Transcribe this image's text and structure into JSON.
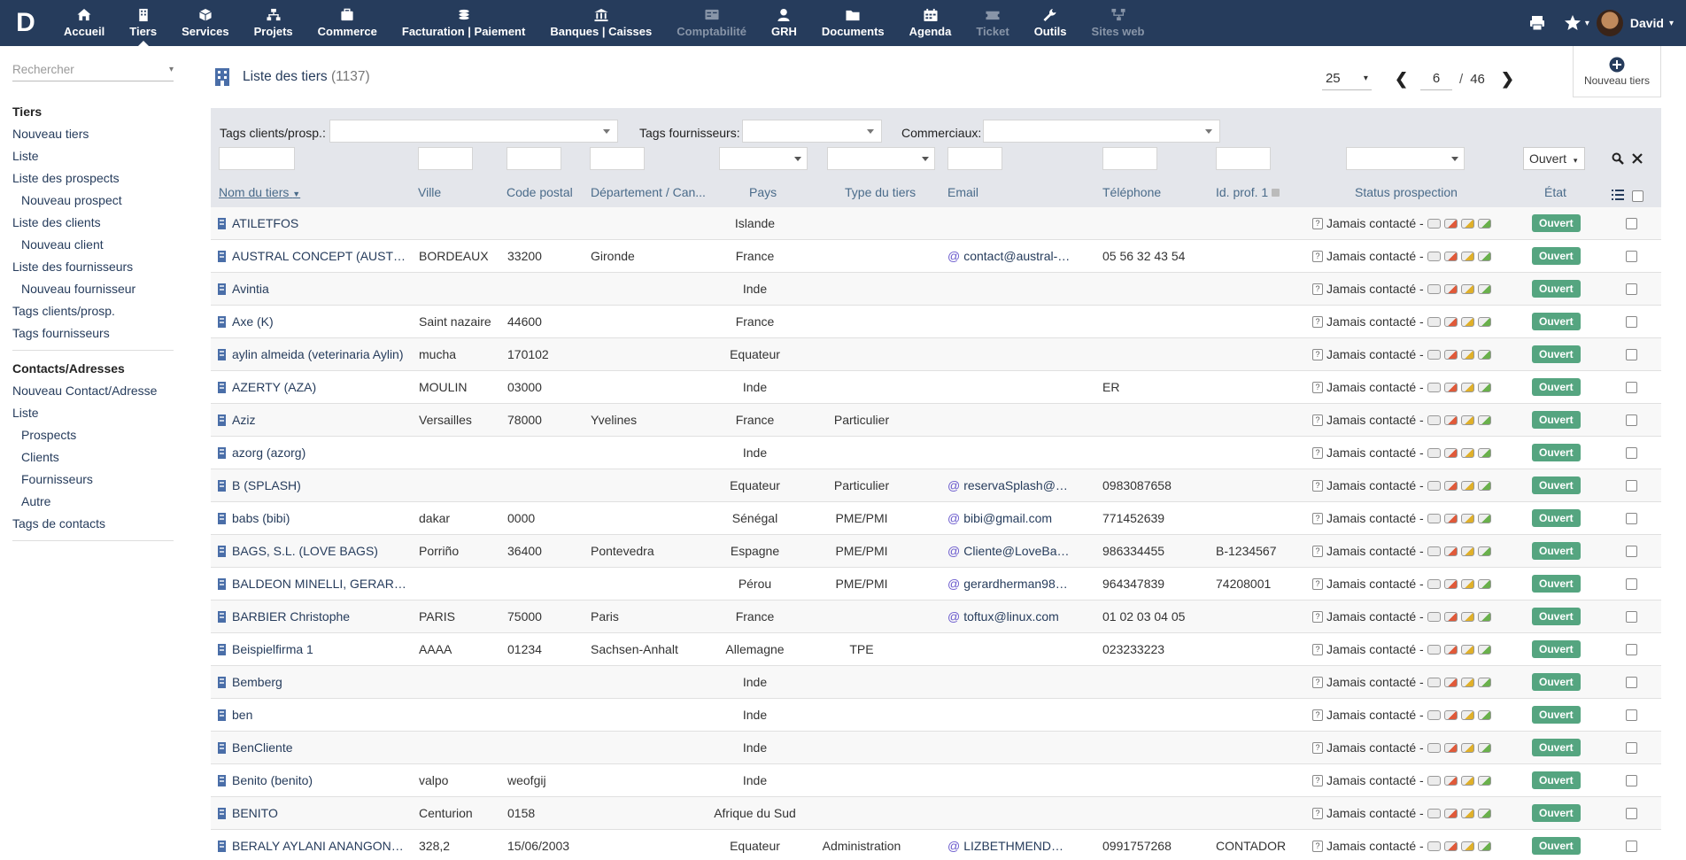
{
  "topbar": {
    "logo": "D",
    "menu": [
      {
        "label": "Accueil",
        "icon": "home-icon",
        "disabled": false
      },
      {
        "label": "Tiers",
        "icon": "building-icon",
        "disabled": false,
        "active": true
      },
      {
        "label": "Services",
        "icon": "cube-icon",
        "disabled": false
      },
      {
        "label": "Projets",
        "icon": "sitemap-icon",
        "disabled": false
      },
      {
        "label": "Commerce",
        "icon": "suitcase-icon",
        "disabled": false
      },
      {
        "label": "Facturation | Paiement",
        "icon": "coins-icon",
        "disabled": false
      },
      {
        "label": "Banques | Caisses",
        "icon": "bank-icon",
        "disabled": false
      },
      {
        "label": "Comptabilité",
        "icon": "ledger-icon",
        "disabled": true
      },
      {
        "label": "GRH",
        "icon": "user-icon",
        "disabled": false
      },
      {
        "label": "Documents",
        "icon": "folder-icon",
        "disabled": false
      },
      {
        "label": "Agenda",
        "icon": "calendar-icon",
        "disabled": false
      },
      {
        "label": "Ticket",
        "icon": "ticket-icon",
        "disabled": true
      },
      {
        "label": "Outils",
        "icon": "wrench-icon",
        "disabled": false
      },
      {
        "label": "Sites web",
        "icon": "network-icon",
        "disabled": true
      }
    ],
    "username": "David"
  },
  "sidebar": {
    "search_placeholder": "Rechercher",
    "sections": [
      {
        "head": "Tiers",
        "links": [
          {
            "label": "Nouveau tiers",
            "sub": false
          },
          {
            "label": "Liste",
            "sub": false
          },
          {
            "label": "Liste des prospects",
            "sub": false
          },
          {
            "label": "Nouveau prospect",
            "sub": true
          },
          {
            "label": "Liste des clients",
            "sub": false
          },
          {
            "label": "Nouveau client",
            "sub": true
          },
          {
            "label": "Liste des fournisseurs",
            "sub": false
          },
          {
            "label": "Nouveau fournisseur",
            "sub": true
          },
          {
            "label": "Tags clients/prosp.",
            "sub": false
          },
          {
            "label": "Tags fournisseurs",
            "sub": false
          }
        ]
      },
      {
        "head": "Contacts/Adresses",
        "links": [
          {
            "label": "Nouveau Contact/Adresse",
            "sub": false
          },
          {
            "label": "Liste",
            "sub": false
          },
          {
            "label": "Prospects",
            "sub": true
          },
          {
            "label": "Clients",
            "sub": true
          },
          {
            "label": "Fournisseurs",
            "sub": true
          },
          {
            "label": "Autre",
            "sub": true
          },
          {
            "label": "Tags de contacts",
            "sub": false
          }
        ]
      }
    ]
  },
  "main": {
    "title": "Liste des tiers",
    "count": "(1137)",
    "per_page": "25",
    "page": "6",
    "page_sep": "/",
    "total_pages": "46",
    "new_button": "Nouveau tiers",
    "filters": {
      "tags_clients_label": "Tags clients/prosp.:",
      "tags_fourn_label": "Tags fournisseurs:",
      "commerciaux_label": "Commerciaux:",
      "etat_value": "Ouvert"
    },
    "columns": {
      "name": "Nom du tiers",
      "ville": "Ville",
      "cp": "Code postal",
      "dep": "Département / Can...",
      "pays": "Pays",
      "type": "Type du tiers",
      "email": "Email",
      "tel": "Téléphone",
      "prof": "Id. prof. 1",
      "status": "Status prospection",
      "etat": "État"
    }
  },
  "rows": [
    {
      "name": "ATILETFOS",
      "ville": "",
      "cp": "",
      "dep": "",
      "pays": "Islande",
      "type": "",
      "email": "",
      "tel": "",
      "prof": "",
      "status": "Jamais contacté -",
      "etat": "Ouvert"
    },
    {
      "name": "AUSTRAL CONCEPT (AUSTRA...",
      "ville": "BORDEAUX",
      "cp": "33200",
      "dep": "Gironde",
      "pays": "France",
      "type": "",
      "email": "contact@austral-con...",
      "tel": "05 56 32 43 54",
      "prof": "",
      "status": "Jamais contacté -",
      "etat": "Ouvert"
    },
    {
      "name": "Avintia",
      "ville": "",
      "cp": "",
      "dep": "",
      "pays": "Inde",
      "type": "",
      "email": "",
      "tel": "",
      "prof": "",
      "status": "Jamais contacté -",
      "etat": "Ouvert"
    },
    {
      "name": "Axe (K)",
      "ville": "Saint nazaire",
      "cp": "44600",
      "dep": "",
      "pays": "France",
      "type": "",
      "email": "",
      "tel": "",
      "prof": "",
      "status": "Jamais contacté -",
      "etat": "Ouvert"
    },
    {
      "name": "aylin almeida (veterinaria Aylin)",
      "ville": "mucha",
      "cp": "170102",
      "dep": "",
      "pays": "Equateur",
      "type": "",
      "email": "",
      "tel": "",
      "prof": "",
      "status": "Jamais contacté -",
      "etat": "Ouvert"
    },
    {
      "name": "AZERTY (AZA)",
      "ville": "MOULIN",
      "cp": "03000",
      "dep": "",
      "pays": "Inde",
      "type": "",
      "email": "",
      "tel": "ER",
      "prof": "",
      "status": "Jamais contacté -",
      "etat": "Ouvert"
    },
    {
      "name": "Aziz",
      "ville": "Versailles",
      "cp": "78000",
      "dep": "Yvelines",
      "pays": "France",
      "type": "Particulier",
      "email": "",
      "tel": "",
      "prof": "",
      "status": "Jamais contacté -",
      "etat": "Ouvert"
    },
    {
      "name": "azorg (azorg)",
      "ville": "",
      "cp": "",
      "dep": "",
      "pays": "Inde",
      "type": "",
      "email": "",
      "tel": "",
      "prof": "",
      "status": "Jamais contacté -",
      "etat": "Ouvert"
    },
    {
      "name": "B (SPLASH)",
      "ville": "",
      "cp": "",
      "dep": "",
      "pays": "Equateur",
      "type": "Particulier",
      "email": "reservaSplash@hotm...",
      "tel": "0983087658",
      "prof": "",
      "status": "Jamais contacté -",
      "etat": "Ouvert"
    },
    {
      "name": "babs (bibi)",
      "ville": "dakar",
      "cp": "0000",
      "dep": "",
      "pays": "Sénégal",
      "type": "PME/PMI",
      "email": "bibi@gmail.com",
      "tel": "771452639",
      "prof": "",
      "status": "Jamais contacté -",
      "etat": "Ouvert"
    },
    {
      "name": "BAGS, S.L. (LOVE BAGS)",
      "ville": "Porriño",
      "cp": "36400",
      "dep": "Pontevedra",
      "pays": "Espagne",
      "type": "PME/PMI",
      "email": "Cliente@LoveBags.c...",
      "tel": "986334455",
      "prof": "B-1234567",
      "status": "Jamais contacté -",
      "etat": "Ouvert"
    },
    {
      "name": "BALDEON MINELLI, GERARD ...",
      "ville": "",
      "cp": "",
      "dep": "",
      "pays": "Pérou",
      "type": "PME/PMI",
      "email": "gerardherman9890@...",
      "tel": "964347839",
      "prof": "74208001",
      "status": "Jamais contacté -",
      "etat": "Ouvert"
    },
    {
      "name": "BARBIER Christophe",
      "ville": "PARIS",
      "cp": "75000",
      "dep": "Paris",
      "pays": "France",
      "type": "",
      "email": "toftux@linux.com",
      "tel": "01 02 03 04 05",
      "prof": "",
      "status": "Jamais contacté -",
      "etat": "Ouvert"
    },
    {
      "name": "Beispielfirma 1",
      "ville": "AAAA",
      "cp": "01234",
      "dep": "Sachsen-Anhalt",
      "pays": "Allemagne",
      "type": "TPE",
      "email": "",
      "tel": "023233223",
      "prof": "",
      "status": "Jamais contacté -",
      "etat": "Ouvert"
    },
    {
      "name": "Bemberg",
      "ville": "",
      "cp": "",
      "dep": "",
      "pays": "Inde",
      "type": "",
      "email": "",
      "tel": "",
      "prof": "",
      "status": "Jamais contacté -",
      "etat": "Ouvert"
    },
    {
      "name": "ben",
      "ville": "",
      "cp": "",
      "dep": "",
      "pays": "Inde",
      "type": "",
      "email": "",
      "tel": "",
      "prof": "",
      "status": "Jamais contacté -",
      "etat": "Ouvert"
    },
    {
      "name": "BenCliente",
      "ville": "",
      "cp": "",
      "dep": "",
      "pays": "Inde",
      "type": "",
      "email": "",
      "tel": "",
      "prof": "",
      "status": "Jamais contacté -",
      "etat": "Ouvert"
    },
    {
      "name": "Benito (benito)",
      "ville": "valpo",
      "cp": "weofgij",
      "dep": "",
      "pays": "Inde",
      "type": "",
      "email": "",
      "tel": "",
      "prof": "",
      "status": "Jamais contacté -",
      "etat": "Ouvert"
    },
    {
      "name": "BENITO",
      "ville": "Centurion",
      "cp": "0158",
      "dep": "",
      "pays": "Afrique du Sud",
      "type": "",
      "email": "",
      "tel": "",
      "prof": "",
      "status": "Jamais contacté -",
      "etat": "Ouvert"
    },
    {
      "name": "BERALY AYLANI ANANGONO ...",
      "ville": "328,2",
      "cp": "15/06/2003",
      "dep": "",
      "pays": "Equateur",
      "type": "Administration",
      "email": "LIZBETHMENDEZ32...",
      "tel": "0991757268",
      "prof": "CONTADOR",
      "status": "Jamais contacté -",
      "etat": "Ouvert"
    }
  ]
}
